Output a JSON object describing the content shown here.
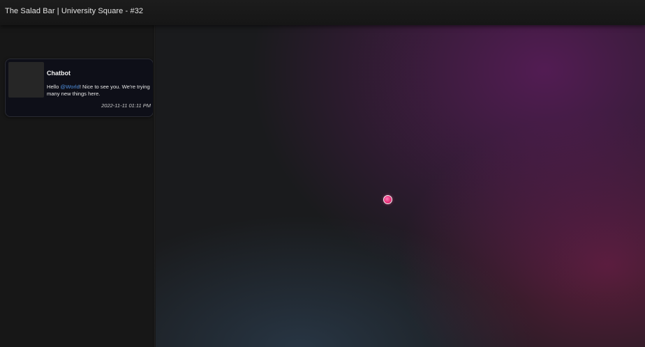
{
  "window": {
    "title": "The Salad Bar | University Square - #32"
  },
  "sidebar": {
    "messages": [
      {
        "sender": "Chatbot",
        "text_before": "Hello ",
        "mention": "@World",
        "text_after": "! Nice to see you. We're trying many new things here.",
        "timestamp": "2022-11-11 01:11 PM"
      }
    ]
  },
  "theme": {
    "mention_color": "#4f8edc",
    "marker_color": "#e8327a",
    "background": "#1a1b1c"
  },
  "icons": {
    "map_marker": "location-dot-icon"
  }
}
